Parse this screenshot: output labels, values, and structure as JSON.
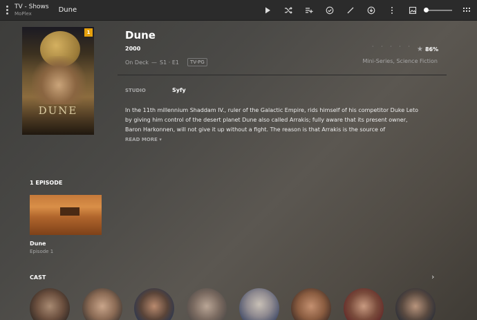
{
  "topbar": {
    "library": "TV - Shows",
    "server": "MoPlex",
    "title": "Dune",
    "icons": [
      "play-icon",
      "shuffle-icon",
      "add-to-playlist-icon",
      "mark-watched-icon",
      "edit-icon",
      "download-icon",
      "more-icon",
      "artwork-icon",
      "size-slider",
      "grid-view-icon"
    ]
  },
  "poster": {
    "title_art": "DUNE",
    "badge": "1"
  },
  "show": {
    "title": "Dune",
    "year": "2000",
    "on_deck": "On Deck",
    "episode": "S1 · E1",
    "content_rating": "TV-PG",
    "rating_dots": "· · · · ·",
    "score": "86%",
    "genres": "Mini-Series, Science Fiction",
    "studio_label": "STUDIO",
    "studio": "Syfy",
    "summary": "In the 11th millennium Shaddam IV., ruler of the Galactic Empire, rids himself of his competitor Duke Leto by giving him control of the desert planet Dune also called Arrakis; fully aware that its present owner, Baron Harkonnen, will not give it up without a fight. The reason is that Arrakis is the source of",
    "read_more": "READ MORE"
  },
  "episodes": {
    "heading": "1 EPISODE",
    "items": [
      {
        "title": "Dune",
        "subtitle": "Episode 1"
      }
    ]
  },
  "cast": {
    "heading": "CAST",
    "next_label": "›"
  },
  "colors": {
    "accent": "#e5a00d",
    "topbar": "#2b2b2b"
  }
}
